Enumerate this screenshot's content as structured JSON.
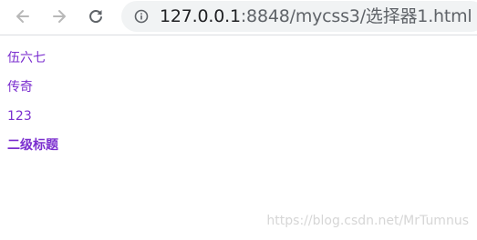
{
  "browser": {
    "address_bar": {
      "url_host": "127.0.0.1",
      "url_rest": ":8848/mycss3/选择器1.html"
    }
  },
  "page": {
    "items": [
      "伍六七",
      "传奇",
      "123"
    ],
    "heading": "二级标题",
    "text_color": "#7b2fcf"
  },
  "watermark": "https://blog.csdn.net/MrTumnus"
}
